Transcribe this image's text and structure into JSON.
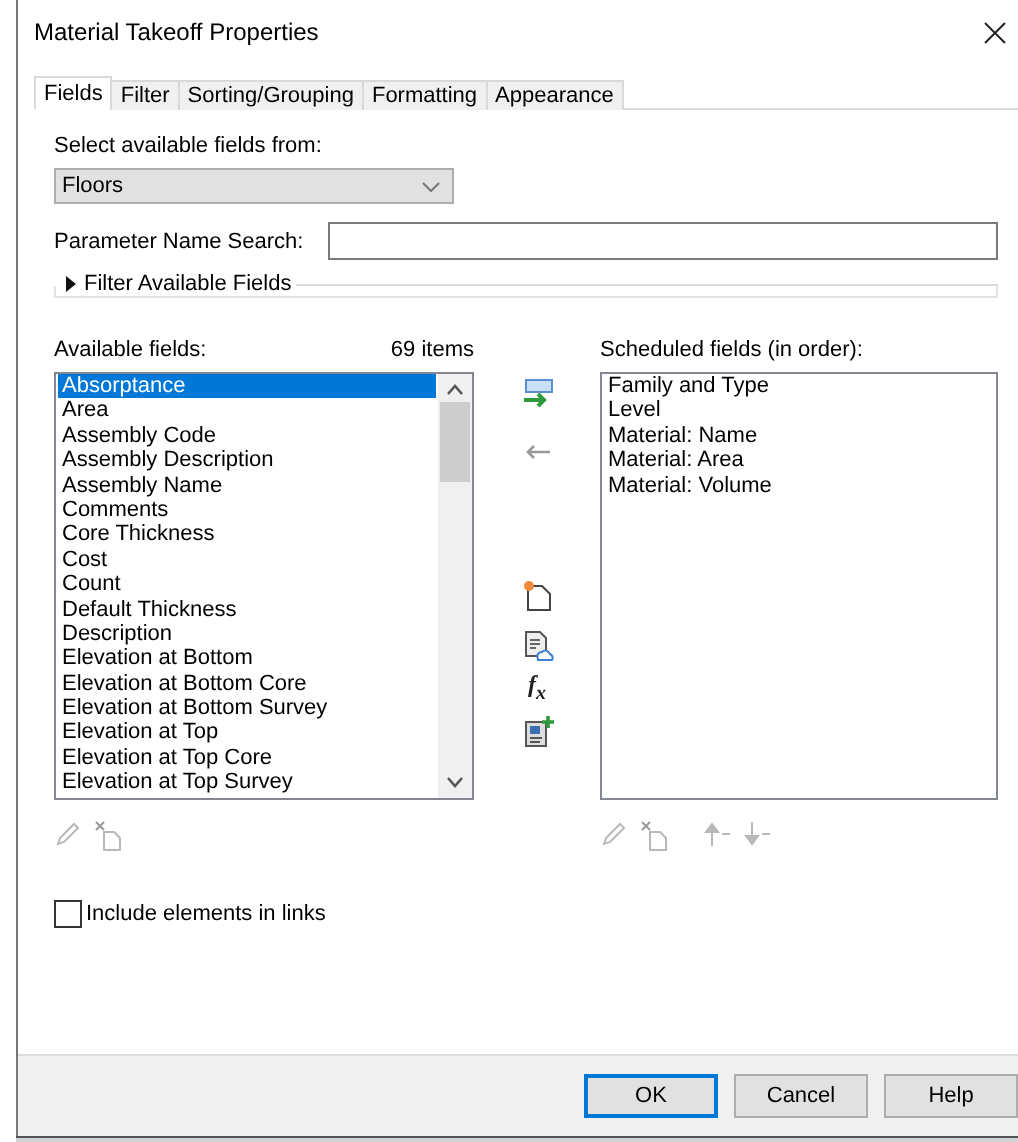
{
  "window": {
    "title": "Material Takeoff Properties"
  },
  "tabs": [
    {
      "label": "Fields",
      "selected": true
    },
    {
      "label": "Filter",
      "selected": false
    },
    {
      "label": "Sorting/Grouping",
      "selected": false
    },
    {
      "label": "Formatting",
      "selected": false
    },
    {
      "label": "Appearance",
      "selected": false
    }
  ],
  "source": {
    "label": "Select available fields from:",
    "value": "Floors"
  },
  "search": {
    "label": "Parameter Name Search:"
  },
  "filter": {
    "label": "Filter Available Fields",
    "expanded": false
  },
  "available": {
    "label": "Available fields:",
    "count": "69 items",
    "items": [
      {
        "label": "Absorptance",
        "selected": true
      },
      {
        "label": "Area",
        "selected": false
      },
      {
        "label": "Assembly Code",
        "selected": false
      },
      {
        "label": "Assembly Description",
        "selected": false
      },
      {
        "label": "Assembly Name",
        "selected": false
      },
      {
        "label": "Comments",
        "selected": false
      },
      {
        "label": "Core Thickness",
        "selected": false
      },
      {
        "label": "Cost",
        "selected": false
      },
      {
        "label": "Count",
        "selected": false
      },
      {
        "label": "Default Thickness",
        "selected": false
      },
      {
        "label": "Description",
        "selected": false
      },
      {
        "label": "Elevation at Bottom",
        "selected": false
      },
      {
        "label": "Elevation at Bottom Core",
        "selected": false
      },
      {
        "label": "Elevation at Bottom Survey",
        "selected": false
      },
      {
        "label": "Elevation at Top",
        "selected": false
      },
      {
        "label": "Elevation at Top Core",
        "selected": false
      },
      {
        "label": "Elevation at Top Survey",
        "selected": false
      }
    ]
  },
  "scheduled": {
    "label": "Scheduled fields (in order):",
    "items": [
      {
        "label": "Family and Type",
        "selected": false
      },
      {
        "label": "Level",
        "selected": false
      },
      {
        "label": "Material: Name",
        "selected": false
      },
      {
        "label": "Material: Area",
        "selected": false
      },
      {
        "label": "Material: Volume",
        "selected": false
      }
    ]
  },
  "formula": "f$_{x}$",
  "include_links": {
    "label": "Include elements in links",
    "checked": false
  },
  "buttons": [
    {
      "label": "OK",
      "kind": "default"
    },
    {
      "label": "Cancel",
      "kind": "normal"
    },
    {
      "label": "Help",
      "kind": "normal"
    }
  ]
}
